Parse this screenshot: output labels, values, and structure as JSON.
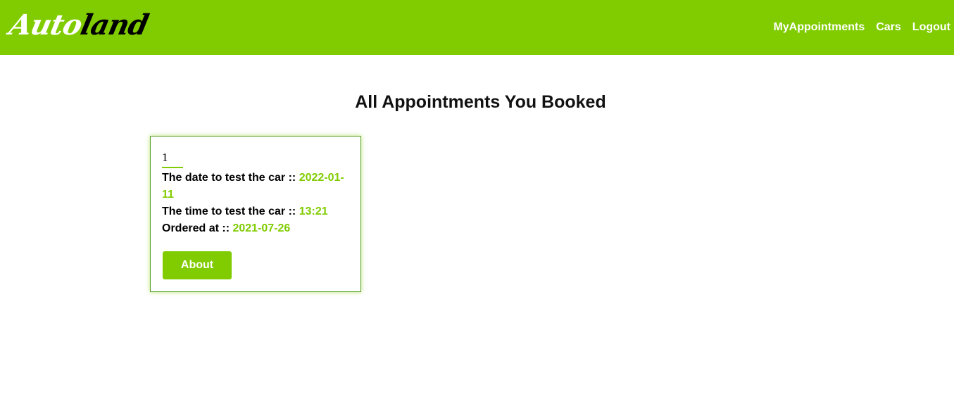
{
  "header": {
    "logo_part1": "Auto",
    "logo_part2": "land",
    "nav": [
      "MyAppointments",
      "Cars",
      "Logout"
    ]
  },
  "main": {
    "title": "All Appointments You Booked",
    "appointments": [
      {
        "index": "1",
        "date_label": "The date to test the car ::",
        "date_value": "2022-01-11",
        "time_label": "The time to test the car ::",
        "time_value": "13:21",
        "ordered_label": "Ordered at ::",
        "ordered_value": "2021-07-26",
        "button_label": "About"
      }
    ]
  },
  "colors": {
    "brand": "#80cc00",
    "text": "#000000",
    "white": "#ffffff"
  }
}
